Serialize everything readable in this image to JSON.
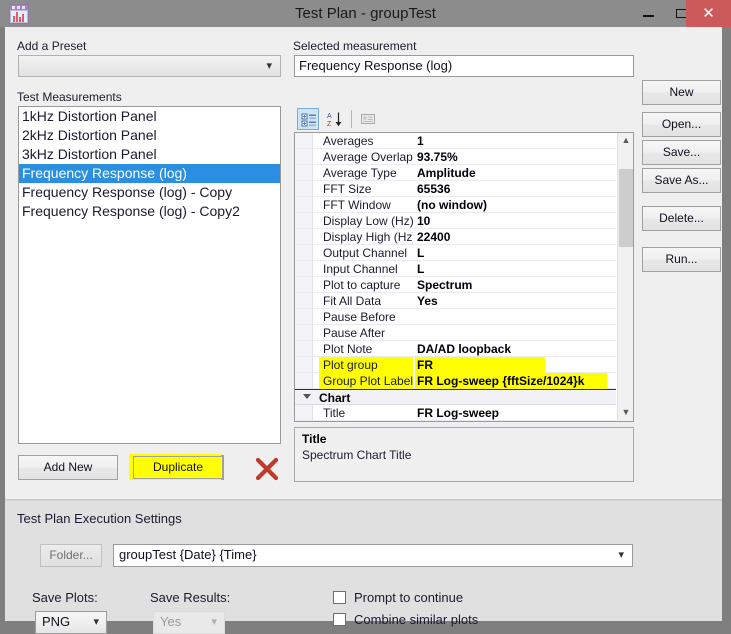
{
  "window": {
    "title": "Test Plan - groupTest",
    "app_icon": "spectrum-analyzer-icon",
    "minimize_label": "–",
    "maximize_label": "□",
    "close_label": "✕"
  },
  "left": {
    "add_preset_label": "Add a Preset",
    "preset_value": "",
    "test_measurements_label": "Test Measurements",
    "measurements": [
      {
        "label": "1kHz Distortion Panel",
        "selected": false
      },
      {
        "label": "2kHz Distortion Panel",
        "selected": false
      },
      {
        "label": "3kHz Distortion Panel",
        "selected": false
      },
      {
        "label": "Frequency Response (log)",
        "selected": true
      },
      {
        "label": "Frequency Response (log) - Copy",
        "selected": false
      },
      {
        "label": "Frequency Response (log) - Copy2",
        "selected": false
      }
    ],
    "add_new_label": "Add New",
    "duplicate_label": "Duplicate",
    "delete_icon": "red-x-delete-icon"
  },
  "center": {
    "selected_measurement_label": "Selected measurement",
    "selected_measurement_value": "Frequency Response (log)",
    "toolbar": {
      "categorized_icon": "categorized-view-icon",
      "alphabetical_icon": "alphabetical-sort-icon",
      "property_pages_icon": "property-pages-icon"
    },
    "properties": [
      {
        "name": "Averages",
        "value": "1",
        "highlight": false,
        "category": false
      },
      {
        "name": "Average Overlap",
        "value": "93.75%",
        "highlight": false,
        "category": false
      },
      {
        "name": "Average Type",
        "value": "Amplitude",
        "highlight": false,
        "category": false
      },
      {
        "name": "FFT Size",
        "value": "65536",
        "highlight": false,
        "category": false
      },
      {
        "name": "FFT Window",
        "value": "(no window)",
        "highlight": false,
        "category": false
      },
      {
        "name": "Display Low (Hz)",
        "value": "10",
        "highlight": false,
        "category": false
      },
      {
        "name": "Display High (Hz)",
        "value": "22400",
        "highlight": false,
        "category": false
      },
      {
        "name": "Output Channel",
        "value": "L",
        "highlight": false,
        "category": false
      },
      {
        "name": "Input Channel",
        "value": "L",
        "highlight": false,
        "category": false
      },
      {
        "name": "Plot to capture",
        "value": "Spectrum",
        "highlight": false,
        "category": false
      },
      {
        "name": "Fit All Data",
        "value": "Yes",
        "highlight": false,
        "category": false
      },
      {
        "name": "Pause Before",
        "value": "",
        "highlight": false,
        "category": false
      },
      {
        "name": "Pause After",
        "value": "",
        "highlight": false,
        "category": false
      },
      {
        "name": "Plot Note",
        "value": "DA/AD loopback",
        "highlight": false,
        "category": false
      },
      {
        "name": "Plot group",
        "value": "FR",
        "highlight": true,
        "category": false
      },
      {
        "name": "Group Plot Label",
        "value": "FR Log-sweep  {fftSize/1024}k",
        "highlight": true,
        "category": false
      },
      {
        "name": "Chart",
        "value": "",
        "highlight": false,
        "category": true
      },
      {
        "name": "Title",
        "value": "FR Log-sweep",
        "highlight": false,
        "category": false
      }
    ],
    "scrollbar": {
      "up_arrow": "▲",
      "down_arrow": "▼"
    },
    "description": {
      "title": "Title",
      "text": "Spectrum Chart Title"
    }
  },
  "side_buttons": [
    {
      "id": "new",
      "label": "New"
    },
    {
      "id": "open",
      "label": "Open..."
    },
    {
      "id": "save",
      "label": "Save..."
    },
    {
      "id": "saveas",
      "label": "Save As..."
    },
    {
      "id": "delete",
      "label": "Delete..."
    },
    {
      "id": "run",
      "label": "Run..."
    }
  ],
  "execution": {
    "group_label": "Test Plan Execution Settings",
    "folder_button_label": "Folder...",
    "folder_value": "groupTest {Date} {Time}",
    "save_plots_label": "Save Plots:",
    "save_plots_value": "PNG",
    "save_results_label": "Save Results:",
    "save_results_value": "Yes",
    "prompt_to_continue_label": "Prompt to continue",
    "prompt_to_continue_checked": false,
    "combine_similar_plots_label": "Combine similar plots",
    "combine_similar_plots_checked": false
  },
  "colors": {
    "highlight_yellow": "#ffff00",
    "selection_blue": "#2a8fe0",
    "close_button_red": "#cc5a5a",
    "delete_x_red": "#c0392b",
    "titlebar_gray": "#8c8c8c"
  }
}
